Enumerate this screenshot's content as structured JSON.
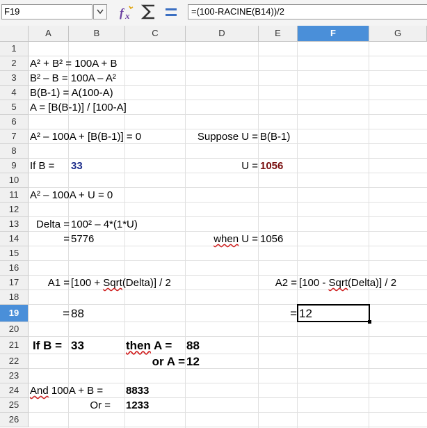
{
  "name_box": "F19",
  "formula": "=(100-RACINE(B14))/2",
  "icons": {
    "dropdown": "chevron-down-icon",
    "function_wizard": "fx-icon",
    "sum": "sigma-icon",
    "formula": "equals-icon"
  },
  "accent_colors": {
    "selection": "#4a8fd9",
    "navy_text": "#1f2f8c",
    "maroon_text": "#7a1010",
    "spell_error": "#d02020"
  },
  "columns": [
    "A",
    "B",
    "C",
    "D",
    "E",
    "F",
    "G"
  ],
  "rows": [
    "1",
    "2",
    "3",
    "4",
    "5",
    "6",
    "7",
    "8",
    "9",
    "10",
    "11",
    "12",
    "13",
    "14",
    "15",
    "16",
    "17",
    "18",
    "19",
    "20",
    "21",
    "22",
    "23",
    "24",
    "25",
    "26"
  ],
  "selected_cell": {
    "column": "F",
    "row": "19"
  },
  "cells": {
    "a2": "A² + B² = 100A + B",
    "a3": "B² – B = 100A – A²",
    "a4": "B(B-1) = A(100-A)",
    "a5": "A = [B(B-1)] / [100-A]",
    "a7": "A² – 100A + [B(B-1)] = 0",
    "d7": "Suppose U =",
    "e7": "B(B-1)",
    "a9": "If B =",
    "b9": "33",
    "d9": "U =",
    "e9": "1056",
    "a11": "A² – 100A + U = 0",
    "a13": "Delta =",
    "b13": "100² – 4*(1*U)",
    "a14": "=",
    "b14": "5776",
    "d14_when": "when",
    "d14_u": " U =",
    "e14": "1056",
    "a17": "A1 =",
    "b17_pre": "[100 + ",
    "b17_sqrt": "Sqrt",
    "b17_post": "(Delta)] / 2",
    "e17": "A2 =",
    "f17_pre": "[100 - ",
    "f17_sqrt": "Sqrt",
    "f17_post": "(Delta)] / 2",
    "a19": "=",
    "b19": "88",
    "e19": "=",
    "f19": "12",
    "a21": "If B =",
    "b21": "33",
    "c21_then": "then",
    "c21_rest": " A =",
    "d21": "88",
    "c22": "or A =",
    "d22": "12",
    "a24_and": "And",
    "a24_rest": " 100A + B =",
    "c24": "8833",
    "a25": "Or =",
    "c25": "1233"
  }
}
